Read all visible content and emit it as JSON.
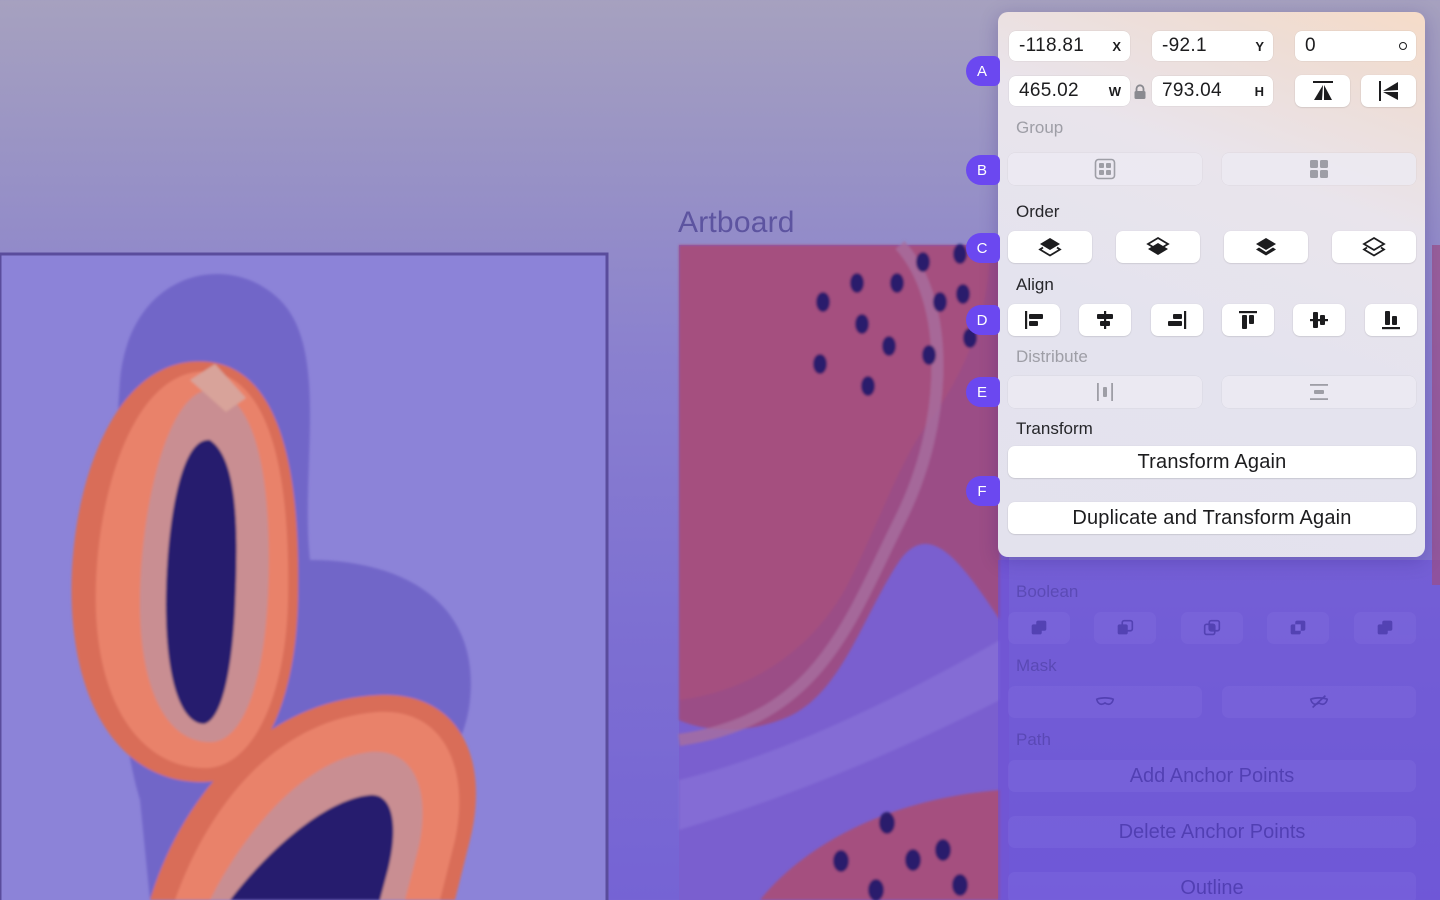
{
  "canvas": {
    "artboard_label": "Artboard"
  },
  "inspector": {
    "position": {
      "x_value": "-118.81",
      "x_unit": "X",
      "y_value": "-92.1",
      "y_unit": "Y",
      "rotation_value": "0"
    },
    "size": {
      "w_value": "465.02",
      "w_unit": "W",
      "h_value": "793.04",
      "h_unit": "H"
    },
    "icons": {
      "flip_vertical": "flip-vertical-icon",
      "flip_horizontal": "flip-horizontal-icon",
      "lock": "lock-icon"
    },
    "sections": {
      "group": "Group",
      "order": "Order",
      "align": "Align",
      "distribute": "Distribute",
      "transform": "Transform"
    },
    "transform_again_label": "Transform Again",
    "duplicate_transform_label": "Duplicate and Transform Again"
  },
  "faded_panel": {
    "boolean": "Boolean",
    "mask": "Mask",
    "path": "Path",
    "add_anchor_label": "Add Anchor Points",
    "delete_anchor_label": "Delete Anchor Points",
    "outline_label": "Outline"
  },
  "badges": [
    "A",
    "B",
    "C",
    "D",
    "E",
    "F"
  ],
  "colors": {
    "accent": "#6b48f0",
    "panel_text": "#1c1c1e",
    "disabled_text": "#9e9ea6"
  }
}
